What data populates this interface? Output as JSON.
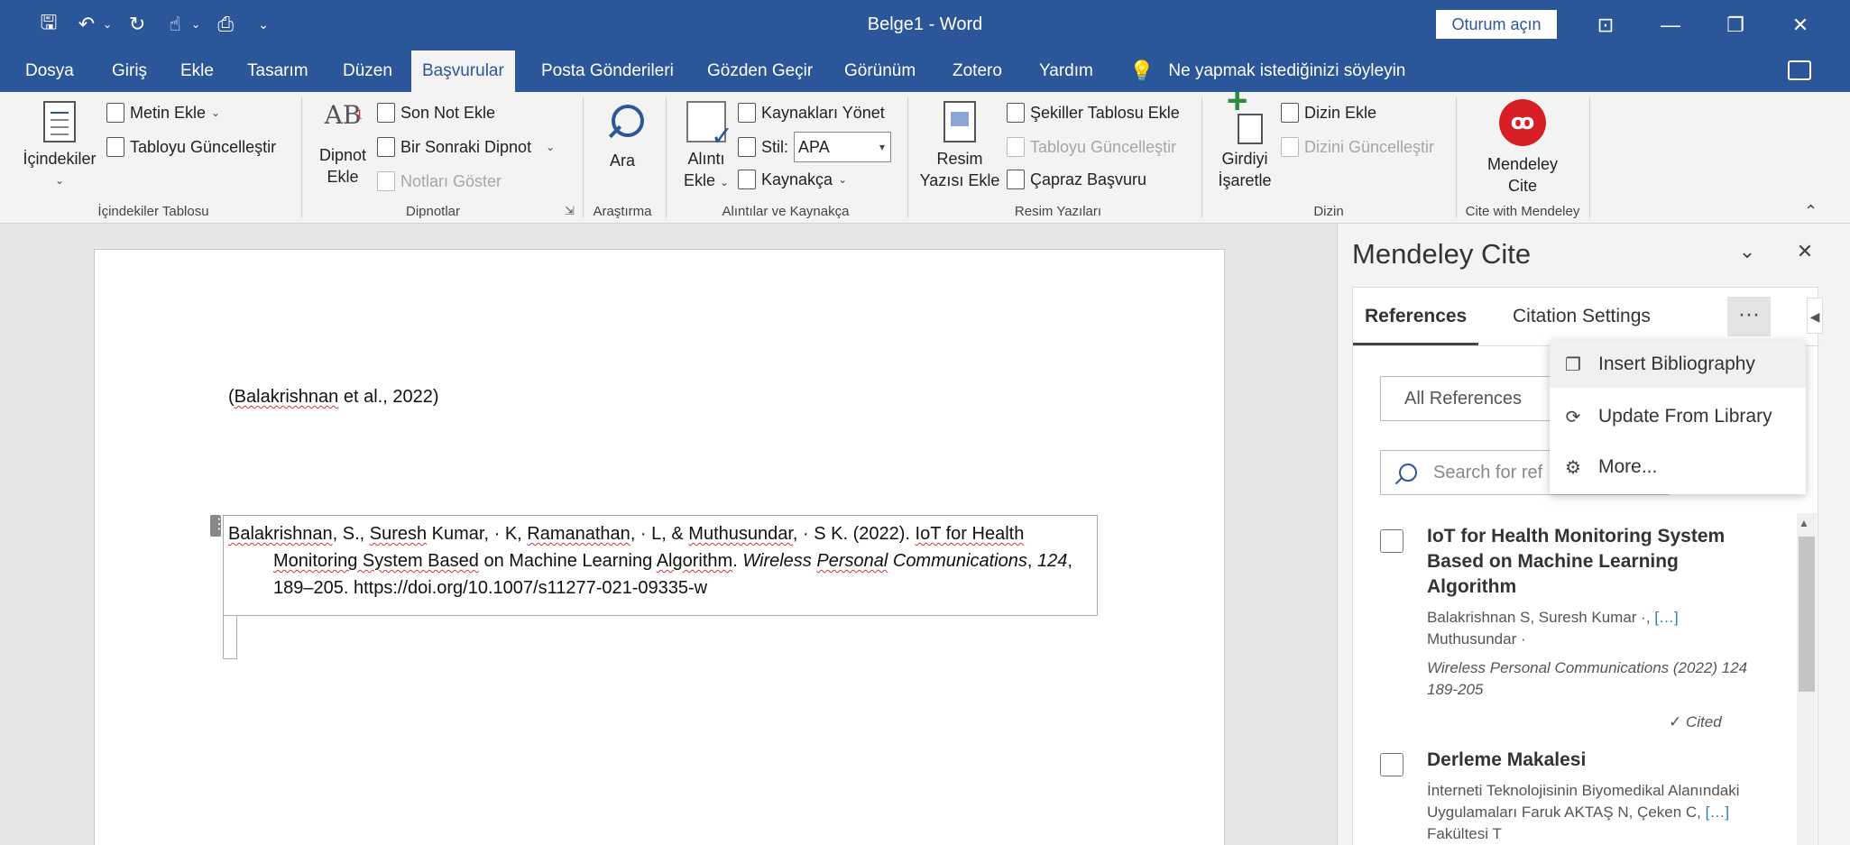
{
  "window": {
    "title": "Belge1  -  Word",
    "signin_label": "Oturum açın"
  },
  "tabs": [
    "Dosya",
    "Giriş",
    "Ekle",
    "Tasarım",
    "Düzen",
    "Başvurular",
    "Posta Gönderileri",
    "Gözden Geçir",
    "Görünüm",
    "Zotero",
    "Yardım"
  ],
  "active_tab": "Başvurular",
  "tell_me": "Ne yapmak istediğinizi söyleyin",
  "ribbon": {
    "toc": {
      "big": "İçindekiler",
      "add_text": "Metin Ekle",
      "update_table": "Tabloyu Güncelleştir",
      "label": "İçindekiler Tablosu"
    },
    "footnotes": {
      "big_line1": "Dipnot",
      "big_line2": "Ekle",
      "endnote": "Son Not Ekle",
      "next_footnote": "Bir Sonraki Dipnot",
      "show_notes": "Notları Göster",
      "label": "Dipnotlar"
    },
    "research": {
      "big": "Ara",
      "label": "Araştırma"
    },
    "citations": {
      "big_line1": "Alıntı",
      "big_line2": "Ekle",
      "manage_sources": "Kaynakları Yönet",
      "style_label": "Stil:",
      "style_value": "APA",
      "bibliography": "Kaynakça",
      "label": "Alıntılar ve Kaynakça"
    },
    "captions": {
      "big_line1": "Resim",
      "big_line2": "Yazısı Ekle",
      "table_of_figures": "Şekiller Tablosu Ekle",
      "update_table": "Tabloyu Güncelleştir",
      "cross_ref": "Çapraz Başvuru",
      "label": "Resim Yazıları"
    },
    "index": {
      "big_line1": "Girdiyi",
      "big_line2": "İşaretle",
      "insert_index": "Dizin Ekle",
      "update_index": "Dizini Güncelleştir",
      "label": "Dizin"
    },
    "mendeley": {
      "big_line1": "Mendeley",
      "big_line2": "Cite",
      "label": "Cite with Mendeley"
    }
  },
  "document": {
    "inline_citation_author": "Balakrishnan",
    "inline_citation_rest": " et al., 2022)",
    "inline_citation_open": "(",
    "bib_parts": {
      "a": "Balakrishnan",
      "b": ", S., ",
      "c": "Suresh",
      "d": " Kumar, · K, ",
      "e": "Ramanathan",
      "f": ", · L, & ",
      "g": "Muthusundar",
      "h": ", · S K. (2022). ",
      "i": "IoT for Health",
      "j": "Monitoring System Based",
      "k": " on Machine Learning ",
      "l": "Algorithm",
      "m": ". ",
      "n": "Wireless ",
      "o": "Personal",
      "p": " Communications",
      "q": ", ",
      "r": "124",
      "s": ", 189–205. https://doi.org/10.1007/s11277-021-09335-w"
    }
  },
  "pane": {
    "title": "Mendeley Cite",
    "tabs": {
      "references": "References",
      "settings": "Citation Settings"
    },
    "more": "···",
    "filter": "All References",
    "search_placeholder": "Search for ref",
    "refs": [
      {
        "title": "IoT for Health Monitoring System Based on Machine Learning Algorithm",
        "authors_a": "Balakrishnan S, Suresh Kumar ·, ",
        "authors_link": "[…]",
        "authors_b": " Muthusundar ·",
        "journal": "Wireless Personal Communications (2022) 124 189-205",
        "status": "Cited"
      },
      {
        "title": "Derleme Makalesi",
        "authors_a": "İnterneti Teknolojisinin Biyomedikal Alanındaki Uygulamaları Faruk AKTAŞ N, Çeken C, ",
        "authors_link": "[…]",
        "authors_b": " Fakültesi T"
      }
    ],
    "menu": [
      "Insert Bibliography",
      "Update From Library",
      "More..."
    ]
  }
}
